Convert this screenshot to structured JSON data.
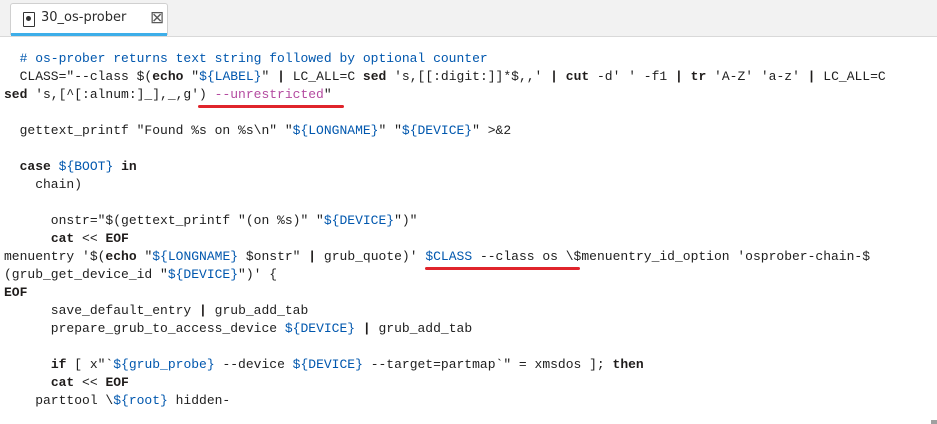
{
  "tab": {
    "title": "30_os-prober",
    "close_glyph": "⊠"
  },
  "code_lines": [
    "  # os-prober returns text string followed by optional counter",
    "  CLASS=\"--class $(echo \"${LABEL}\" | LC_ALL=C sed 's,[[:digit:]]*$,,' | cut -d' ' -f1 | tr 'A-Z' 'a-z' | LC_ALL=C",
    "sed 's,[^[:alnum:]_],_,g') --unrestricted\"",
    "",
    "  gettext_printf \"Found %s on %s\\n\" \"${LONGNAME}\" \"${DEVICE}\" >&2",
    "",
    "  case ${BOOT} in",
    "    chain)",
    "",
    "      onstr=\"$(gettext_printf \"(on %s)\" \"${DEVICE}\")\"",
    "      cat << EOF",
    "menuentry '$(echo \"${LONGNAME} $onstr\" | grub_quote)' $CLASS --class os \\$menuentry_id_option 'osprober-chain-$",
    "(grub_get_device_id \"${DEVICE}\")' {",
    "EOF",
    "      save_default_entry | grub_add_tab",
    "      prepare_grub_to_access_device ${DEVICE} | grub_add_tab",
    "",
    "      if [ x\"`${grub_probe} --device ${DEVICE} --target=partmap`\" = xmsdos ]; then",
    "      cat << EOF",
    "    parttool \\${root} hidden-"
  ],
  "colors": {
    "annotation": "#e0242b",
    "tab_accent": "#3daee9"
  }
}
